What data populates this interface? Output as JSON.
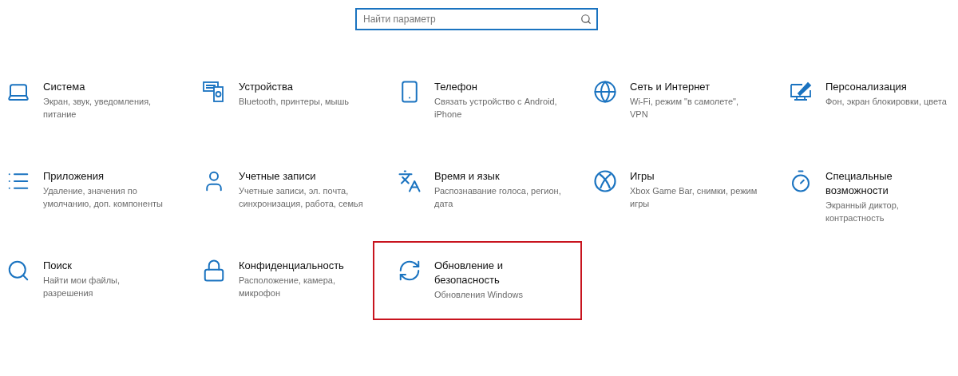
{
  "search": {
    "placeholder": "Найти параметр"
  },
  "tiles": [
    {
      "title": "Система",
      "description": "Экран, звук, уведомления, питание",
      "highlighted": false
    },
    {
      "title": "Устройства",
      "description": "Bluetooth, принтеры, мышь",
      "highlighted": false
    },
    {
      "title": "Телефон",
      "description": "Связать устройство с Android, iPhone",
      "highlighted": false
    },
    {
      "title": "Сеть и Интернет",
      "description": "Wi-Fi, режим \"в самолете\", VPN",
      "highlighted": false
    },
    {
      "title": "Персонализация",
      "description": "Фон, экран блокировки, цвета",
      "highlighted": false
    },
    {
      "title": "Приложения",
      "description": "Удаление, значения по умолчанию, доп. компоненты",
      "highlighted": false
    },
    {
      "title": "Учетные записи",
      "description": "Учетные записи, эл. почта, синхронизация, работа, семья",
      "highlighted": false
    },
    {
      "title": "Время и язык",
      "description": "Распознавание голоса, регион, дата",
      "highlighted": false
    },
    {
      "title": "Игры",
      "description": "Xbox Game Bar, снимки, режим игры",
      "highlighted": false
    },
    {
      "title": "Специальные возможности",
      "description": "Экранный диктор, контрастность",
      "highlighted": false
    },
    {
      "title": "Поиск",
      "description": "Найти мои файлы, разрешения",
      "highlighted": false
    },
    {
      "title": "Конфиденциальность",
      "description": "Расположение, камера, микрофон",
      "highlighted": false
    },
    {
      "title": "Обновление и безопасность",
      "description": "Обновления Windows",
      "highlighted": true
    }
  ]
}
